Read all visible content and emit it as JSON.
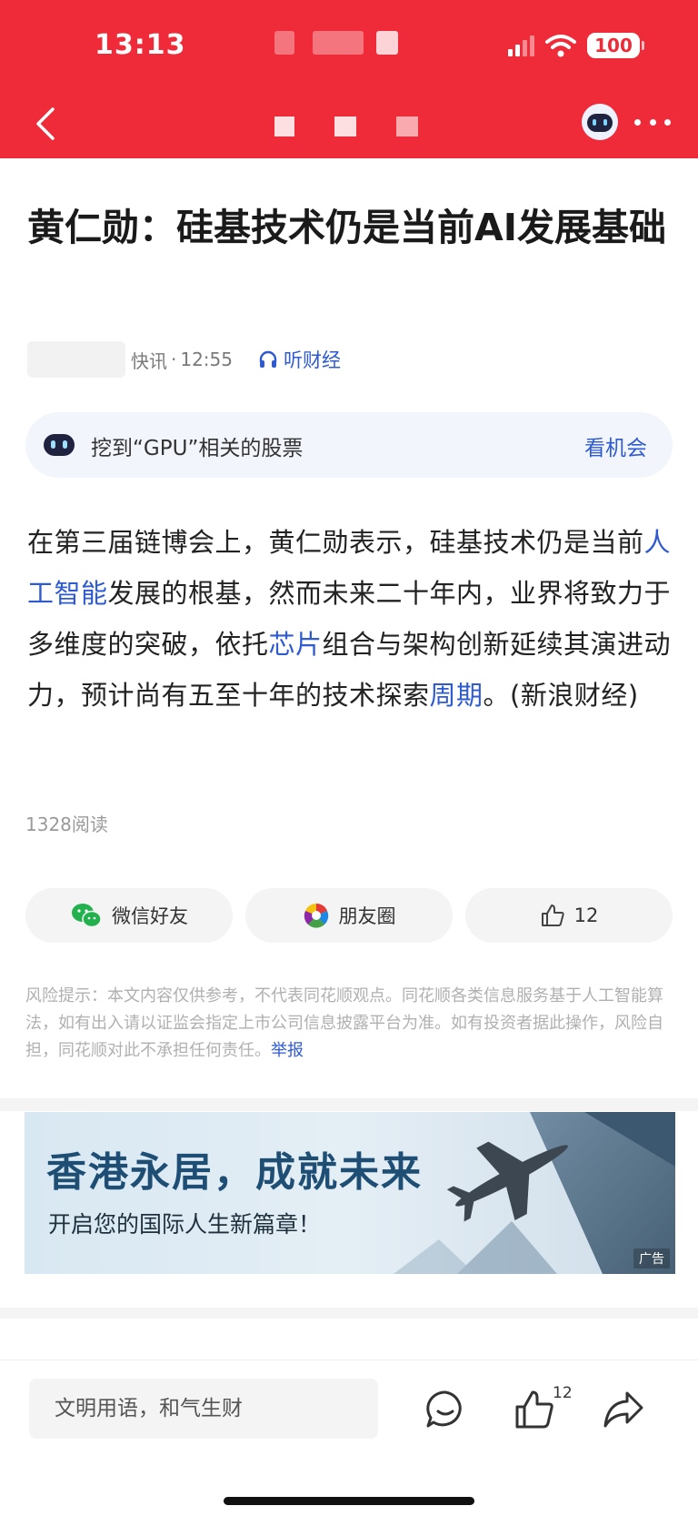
{
  "status_bar": {
    "time": "13:13",
    "battery": "100"
  },
  "header": {
    "back_label": "返回"
  },
  "article": {
    "title": "黄仁勋：硅基技术仍是当前AI发展基础",
    "category": "快讯",
    "time": "12:55",
    "listen_label": "听财经",
    "ai_banner": {
      "text": "挖到“GPU”相关的股票",
      "action": "看机会"
    },
    "body": {
      "p1": "在第三届链博会上，黄仁勋表示，硅基技术仍是当前",
      "link1": "人工智能",
      "p2": "发展的根基，然而未来二十年内，业界将致力于多维度的突破，依托",
      "link2": "芯片",
      "p3": "组合与架构创新延续其演进动力，预计尚有五至十年的技术探索",
      "link3": "周期",
      "p4": "。(新浪财经)"
    },
    "read_count": "1328阅读"
  },
  "share": {
    "wechat": "微信好友",
    "moments": "朋友圈",
    "like_count": "12"
  },
  "risk_notice": {
    "text": "风险提示：本文内容仅供参考，不代表同花顺观点。同花顺各类信息服务基于人工智能算法，如有出入请以证监会指定上市公司信息披露平台为准。如有投资者据此操作，风险自担，同花顺对此不承担任何责任。",
    "report_link": "举报"
  },
  "ad": {
    "headline": "香港永居，成就未来",
    "subline": "开启您的国际人生新篇章！",
    "tag": "广告"
  },
  "bottom_bar": {
    "comment_placeholder": "文明用语，和气生财",
    "like_count": "12"
  },
  "colors": {
    "header_red": "#ef2b39",
    "link_blue": "#2e5bd0"
  }
}
